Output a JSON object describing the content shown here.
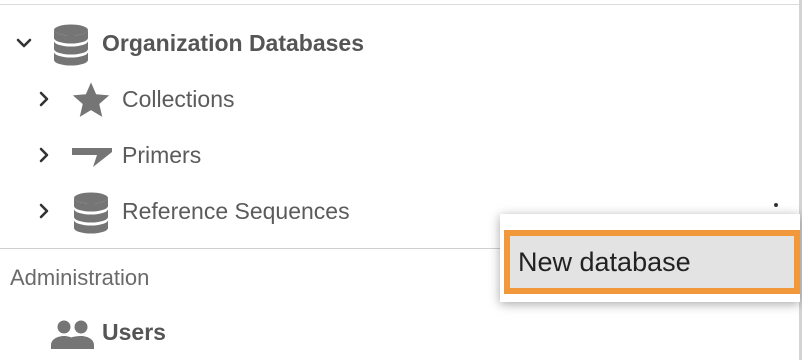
{
  "tree": {
    "root": {
      "label": "Organization Databases",
      "icon": "database-icon",
      "expanded": true
    },
    "children": [
      {
        "label": "Collections",
        "icon": "star-icon"
      },
      {
        "label": "Primers",
        "icon": "primer-icon"
      },
      {
        "label": "Reference Sequences",
        "icon": "database-icon"
      }
    ]
  },
  "administration": {
    "title": "Administration",
    "items": [
      {
        "label": "Users",
        "icon": "users-icon"
      }
    ]
  },
  "context_menu": {
    "items": [
      {
        "label": "New database"
      }
    ],
    "highlight_color": "#f0983a"
  }
}
